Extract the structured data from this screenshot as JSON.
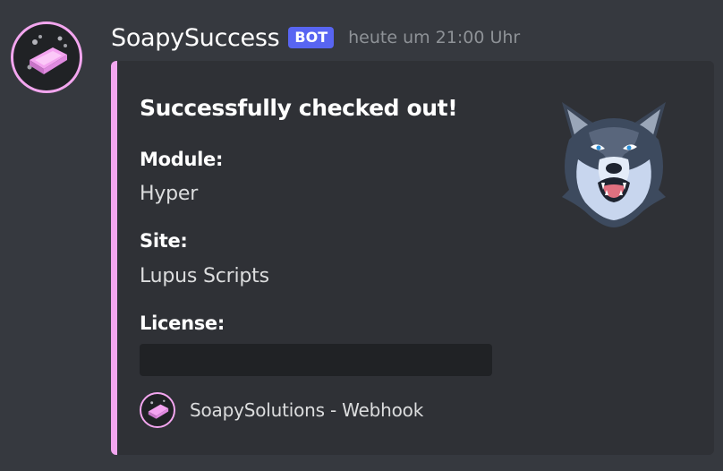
{
  "message": {
    "username": "SoapySuccess",
    "bot_tag": "BOT",
    "timestamp": "heute um 21:00 Uhr",
    "avatar_icon": "soap-bar-icon"
  },
  "embed": {
    "accent_color": "#f3a6ef",
    "title": "Successfully checked out!",
    "thumbnail_icon": "wolf-head-icon",
    "fields": [
      {
        "name": "Module:",
        "value": "Hyper"
      },
      {
        "name": "Site:",
        "value": "Lupus Scripts"
      },
      {
        "name": "License:",
        "value": ""
      }
    ],
    "footer": {
      "icon": "soap-bar-icon",
      "text": "SoapySolutions - Webhook"
    }
  },
  "colors": {
    "background": "#36393f",
    "embed_background": "#2f3136",
    "bot_tag": "#5865f2"
  }
}
